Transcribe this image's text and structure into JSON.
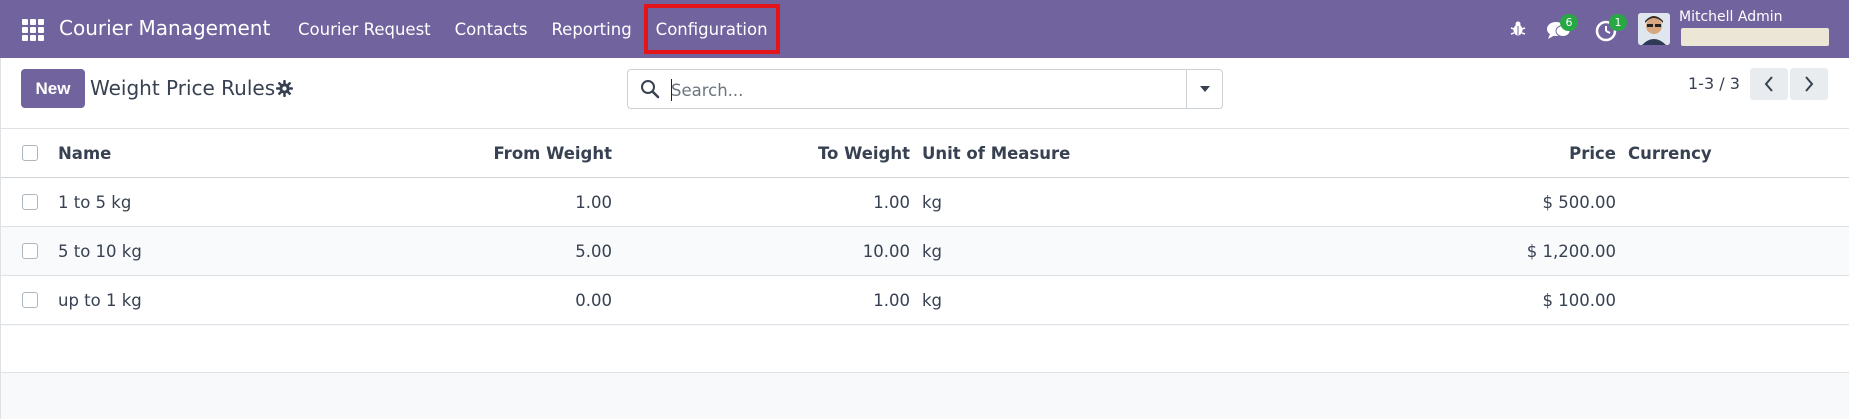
{
  "navbar": {
    "brand": "Courier Management",
    "menu": [
      {
        "label": "Courier Request"
      },
      {
        "label": "Contacts"
      },
      {
        "label": "Reporting"
      },
      {
        "label": "Configuration"
      }
    ],
    "messages_count": "6",
    "activities_count": "1",
    "user_name": "Mitchell Admin",
    "accent_color": "#71639e",
    "highlight_color": "#e3151a"
  },
  "control": {
    "new_label": "New",
    "title": "Weight Price Rules",
    "search_placeholder": "Search...",
    "pager": "1-3 / 3"
  },
  "table": {
    "headers": {
      "name": "Name",
      "from_weight": "From Weight",
      "to_weight": "To Weight",
      "uom": "Unit of Measure",
      "price": "Price",
      "currency": "Currency"
    },
    "rows": [
      {
        "name": "1 to 5 kg",
        "from_weight": "1.00",
        "to_weight": "1.00",
        "uom": "kg",
        "price": "$ 500.00",
        "currency": ""
      },
      {
        "name": "5 to 10 kg",
        "from_weight": "5.00",
        "to_weight": "10.00",
        "uom": "kg",
        "price": "$ 1,200.00",
        "currency": ""
      },
      {
        "name": "up to 1 kg",
        "from_weight": "0.00",
        "to_weight": "1.00",
        "uom": "kg",
        "price": "$ 100.00",
        "currency": ""
      }
    ]
  }
}
